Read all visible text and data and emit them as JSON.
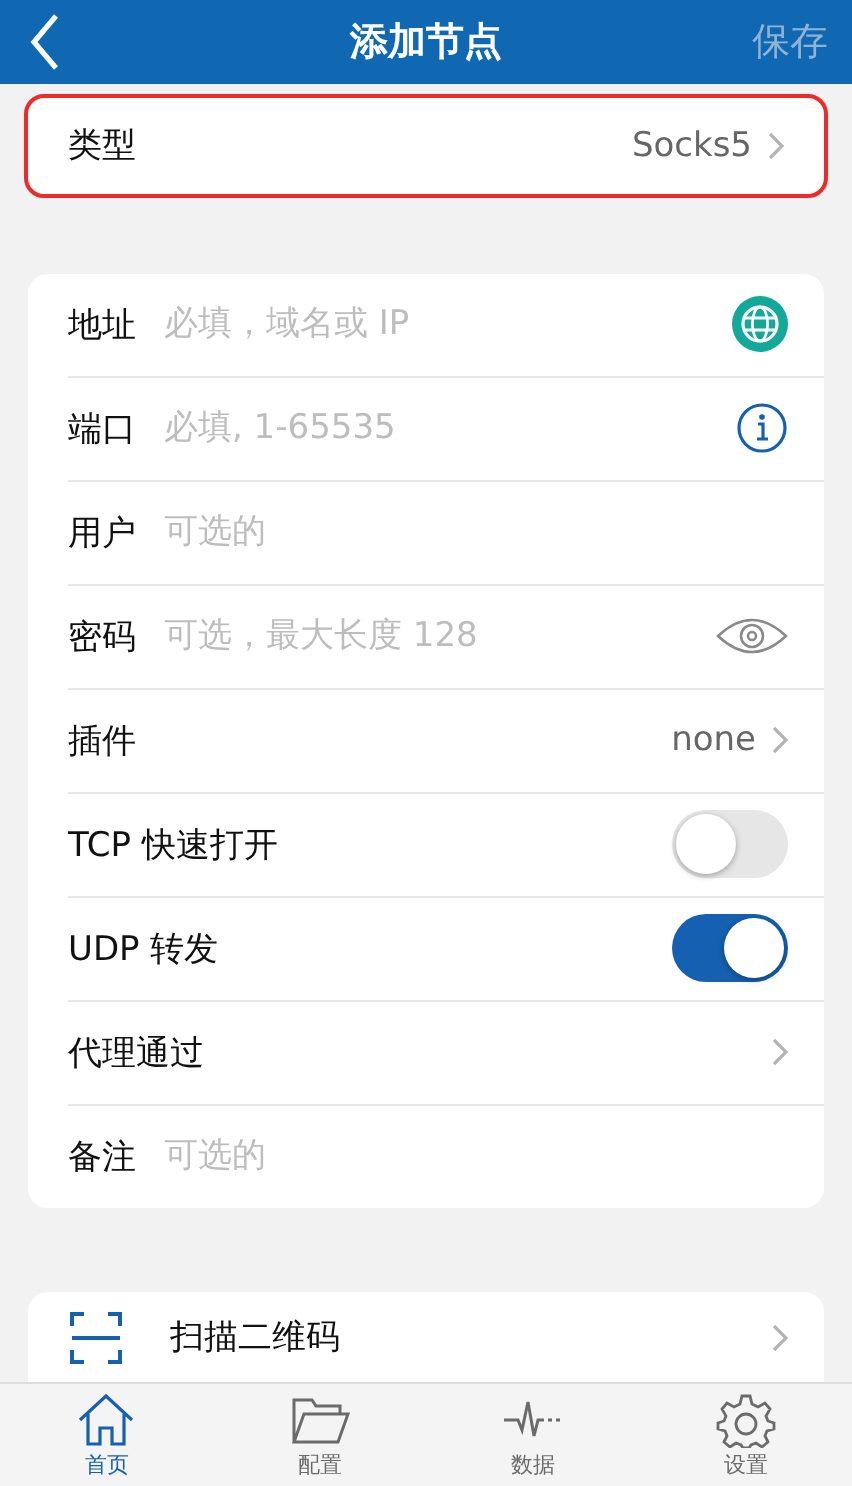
{
  "header": {
    "back": true,
    "title": "添加节点",
    "save": "保存",
    "save_disabled": true
  },
  "type_row": {
    "label": "类型",
    "value": "Socks5",
    "highlighted": true
  },
  "rows": [
    {
      "kind": "lookup",
      "label": "地址",
      "placeholder": "必填，域名或 IP"
    },
    {
      "kind": "info",
      "label": "端口",
      "placeholder": "必填, 1-65535"
    },
    {
      "kind": "field",
      "label": "用户",
      "placeholder": "可选的"
    },
    {
      "kind": "secret",
      "label": "密码",
      "placeholder": "可选，最大长度 128"
    },
    {
      "kind": "link",
      "label": "插件",
      "value": "none"
    },
    {
      "kind": "toggle",
      "label": "TCP 快速打开",
      "on": false
    },
    {
      "kind": "toggle",
      "label": "UDP 转发",
      "on": true
    },
    {
      "kind": "link",
      "label": "代理通过"
    },
    {
      "kind": "field",
      "label": "备注",
      "placeholder": "可选的"
    }
  ],
  "scan": {
    "label": "扫描二维码"
  },
  "tabs": [
    {
      "label": "首页",
      "selected": true,
      "kind": "home"
    },
    {
      "label": "配置",
      "selected": false,
      "kind": "folder"
    },
    {
      "label": "数据",
      "selected": false,
      "kind": "pulse"
    },
    {
      "label": "设置",
      "selected": false,
      "kind": "gear"
    }
  ]
}
